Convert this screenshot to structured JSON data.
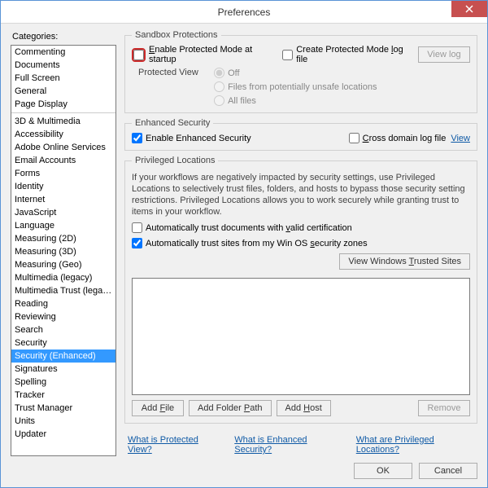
{
  "window": {
    "title": "Preferences"
  },
  "categories": {
    "label": "Categories:",
    "group1": [
      "Commenting",
      "Documents",
      "Full Screen",
      "General",
      "Page Display"
    ],
    "group2": [
      "3D & Multimedia",
      "Accessibility",
      "Adobe Online Services",
      "Email Accounts",
      "Forms",
      "Identity",
      "Internet",
      "JavaScript",
      "Language",
      "Measuring (2D)",
      "Measuring (3D)",
      "Measuring (Geo)",
      "Multimedia (legacy)",
      "Multimedia Trust (legacy)",
      "Reading",
      "Reviewing",
      "Search",
      "Security",
      "Security (Enhanced)",
      "Signatures",
      "Spelling",
      "Tracker",
      "Trust Manager",
      "Units",
      "Updater"
    ],
    "selected": "Security (Enhanced)"
  },
  "sandbox": {
    "legend": "Sandbox Protections",
    "enable_pm_pre": "",
    "enable_pm_mn": "E",
    "enable_pm_post": "nable Protected Mode at startup",
    "create_log": "Create Protected Mode log file",
    "create_log_mn": "l",
    "view_log": "View log",
    "pv_label": "Protected View",
    "pv_off": "Off",
    "pv_unsafe": "Files from potentially unsafe locations",
    "pv_all": "All files"
  },
  "enhanced": {
    "legend": "Enhanced Security",
    "enable": "Enable Enhanced Security",
    "cross_pre": "",
    "cross_mn": "C",
    "cross_post": "ross domain log file",
    "view": "View"
  },
  "priv": {
    "legend": "Privileged Locations",
    "desc": "If your workflows are negatively impacted by security settings, use Privileged Locations to selectively trust files, folders, and hosts to bypass those security setting restrictions. Privileged Locations allows you to work securely while granting trust to items in your workflow.",
    "auto_docs_pre": "Automatically trust documents with ",
    "auto_docs_mn": "v",
    "auto_docs_post": "alid certification",
    "auto_sites_pre": "Automatically trust sites from my Win OS ",
    "auto_sites_mn": "s",
    "auto_sites_post": "ecurity zones",
    "view_trusted_pre": "View Windows ",
    "view_trusted_mn": "T",
    "view_trusted_post": "rusted Sites",
    "add_file_pre": "Add ",
    "add_file_mn": "F",
    "add_file_post": "ile",
    "add_folder_pre": "Add Folder ",
    "add_folder_mn": "P",
    "add_folder_post": "ath",
    "add_host_pre": "Add ",
    "add_host_mn": "H",
    "add_host_post": "ost",
    "remove": "Remove"
  },
  "help": {
    "pv": "What is Protected View?",
    "es": "What is Enhanced Security?",
    "pl": "What are Privileged Locations?"
  },
  "dialog": {
    "ok": "OK",
    "cancel": "Cancel"
  }
}
